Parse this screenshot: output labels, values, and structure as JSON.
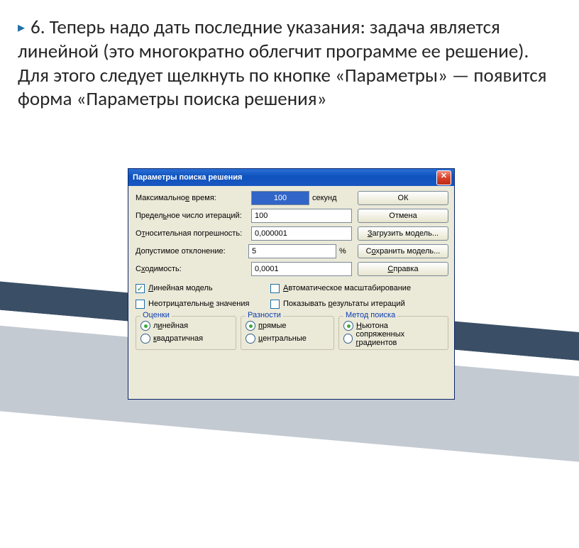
{
  "bullet_text": "6. Теперь надо дать последние указания: задача является линейной (это многократно облегчит программе ее решение). Для этого следует щелкнуть по кнопке «Параметры» — появится форма «Параметры поиска решения»",
  "dialog": {
    "title": "Параметры поиска решения",
    "close_label": "✕",
    "rows": {
      "max_time": {
        "label": "Максимальное время:",
        "value": "100",
        "unit": "секунд"
      },
      "iterations": {
        "label": "Предельное число итераций:",
        "value": "100"
      },
      "tolerance": {
        "label": "Относительная погрешность:",
        "value": "0,000001"
      },
      "deviation": {
        "label": "Допустимое отклонение:",
        "value": "5",
        "unit": "%"
      },
      "convergence": {
        "label": "Сходимость:",
        "value": "0,0001"
      }
    },
    "buttons": {
      "ok": "ОК",
      "cancel": "Отмена",
      "load": "Загрузить модель...",
      "save": "Сохранить модель...",
      "help": "Справка"
    },
    "checks": {
      "linear": {
        "label": "Линейная модель",
        "checked": true
      },
      "nonneg": {
        "label": "Неотрицательные значения",
        "checked": false
      },
      "autoscale": {
        "label": "Автоматическое масштабирование",
        "checked": false
      },
      "showiter": {
        "label": "Показывать результаты итераций",
        "checked": false
      }
    },
    "groups": {
      "estimates": {
        "legend": "Оценки",
        "opts": [
          {
            "label": "линейная",
            "checked": true
          },
          {
            "label": "квадратичная",
            "checked": false
          }
        ]
      },
      "derivatives": {
        "legend": "Разности",
        "opts": [
          {
            "label": "прямые",
            "checked": true
          },
          {
            "label": "центральные",
            "checked": false
          }
        ]
      },
      "search": {
        "legend": "Метод поиска",
        "opts": [
          {
            "label": "Ньютона",
            "checked": true
          },
          {
            "label": "сопряженных градиентов",
            "checked": false
          }
        ]
      }
    }
  }
}
